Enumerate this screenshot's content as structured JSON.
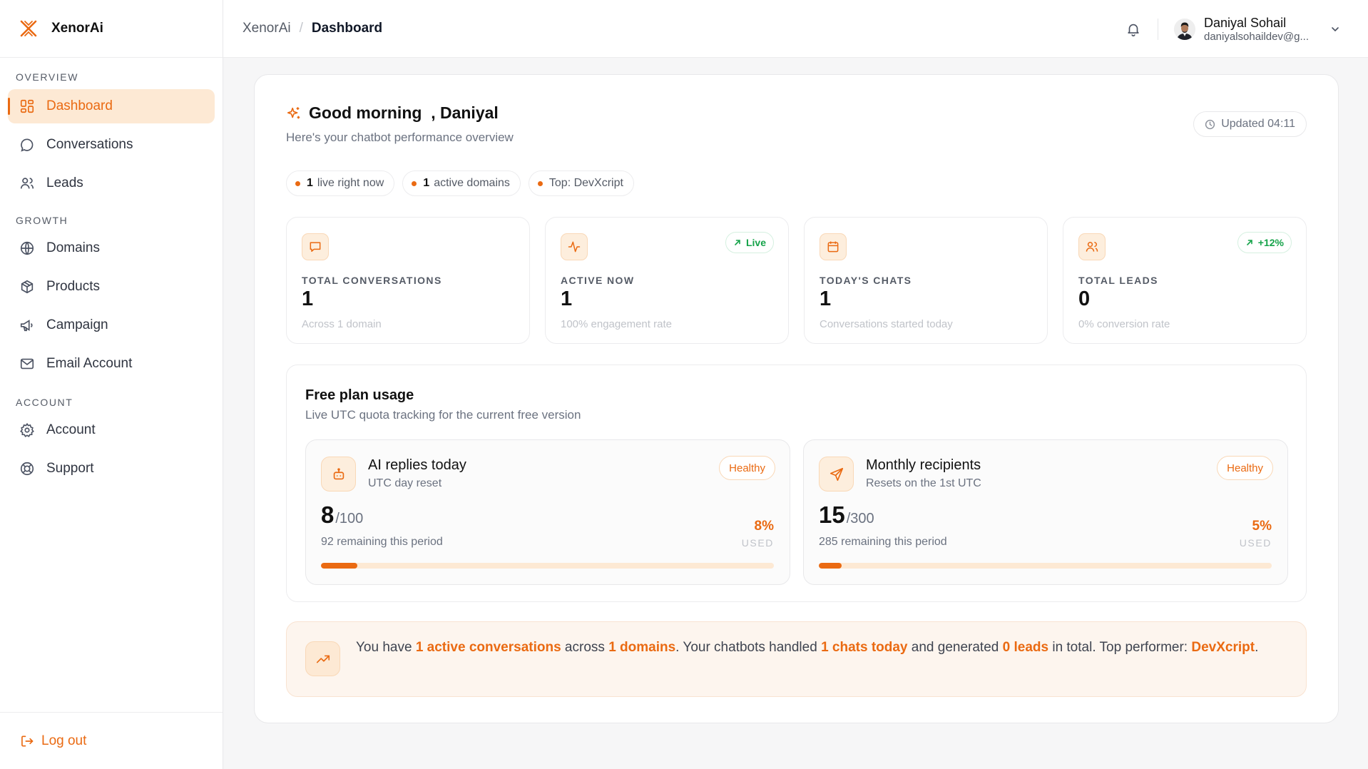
{
  "brand": {
    "name": "XenorAi"
  },
  "colors": {
    "accent": "#ea6a12",
    "accent_soft": "#fde9d4",
    "success": "#16a34a"
  },
  "sidebar": {
    "sections": [
      {
        "title": "OVERVIEW",
        "items": [
          {
            "label": "Dashboard",
            "icon": "grid-icon",
            "active": true
          },
          {
            "label": "Conversations",
            "icon": "chat-icon"
          },
          {
            "label": "Leads",
            "icon": "users-icon"
          }
        ]
      },
      {
        "title": "GROWTH",
        "items": [
          {
            "label": "Domains",
            "icon": "globe-icon"
          },
          {
            "label": "Products",
            "icon": "box-icon"
          },
          {
            "label": "Campaign",
            "icon": "megaphone-icon"
          },
          {
            "label": "Email Account",
            "icon": "mail-icon"
          }
        ]
      },
      {
        "title": "ACCOUNT",
        "items": [
          {
            "label": "Account",
            "icon": "gear-icon"
          },
          {
            "label": "Support",
            "icon": "lifebuoy-icon"
          }
        ]
      }
    ],
    "logout_label": "Log out"
  },
  "header": {
    "breadcrumb_root": "XenorAi",
    "breadcrumb_sep": "/",
    "breadcrumb_current": "Dashboard",
    "user_name": "Daniyal Sohail",
    "user_email": "daniyalsohaildev@g..."
  },
  "greeting": {
    "title": "Good morning  , Daniyal",
    "subtitle": "Here's your chatbot performance overview",
    "updated": "Updated 04:11"
  },
  "chips": [
    {
      "count": "1",
      "label": "live right now"
    },
    {
      "count": "1",
      "label": "active domains"
    },
    {
      "count": "",
      "label": "Top: DevXcript"
    }
  ],
  "stats": [
    {
      "label": "TOTAL CONVERSATIONS",
      "value": "1",
      "sub": "Across 1 domain",
      "icon": "chat-icon",
      "badge": ""
    },
    {
      "label": "ACTIVE NOW",
      "value": "1",
      "sub": "100% engagement rate",
      "icon": "activity-icon",
      "badge": "Live"
    },
    {
      "label": "TODAY'S CHATS",
      "value": "1",
      "sub": "Conversations started today",
      "icon": "calendar-icon",
      "badge": ""
    },
    {
      "label": "TOTAL LEADS",
      "value": "0",
      "sub": "0% conversion rate",
      "icon": "users-icon",
      "badge": "+12%"
    }
  ],
  "usage": {
    "title": "Free plan usage",
    "subtitle": "Live UTC quota tracking for the current free version",
    "meters": [
      {
        "title": "AI replies today",
        "sub": "UTC day reset",
        "badge": "Healthy",
        "used": "8",
        "total": "/100",
        "remaining": "92 remaining this period",
        "pct": "8%",
        "used_label": "USED",
        "fraction": 0.08,
        "icon": "bot-icon"
      },
      {
        "title": "Monthly recipients",
        "sub": "Resets on the 1st UTC",
        "badge": "Healthy",
        "used": "15",
        "total": "/300",
        "remaining": "285 remaining this period",
        "pct": "5%",
        "used_label": "USED",
        "fraction": 0.05,
        "icon": "send-icon"
      }
    ]
  },
  "summary": {
    "t1": "You have ",
    "h1": "1 active conversations",
    "t2": " across ",
    "h2": "1 domains",
    "t3": ". Your chatbots handled ",
    "h3": "1 chats today",
    "t4": " and generated ",
    "h4": "0 leads",
    "t5": " in total. Top performer: ",
    "h5": "DevXcript",
    "t6": "."
  }
}
